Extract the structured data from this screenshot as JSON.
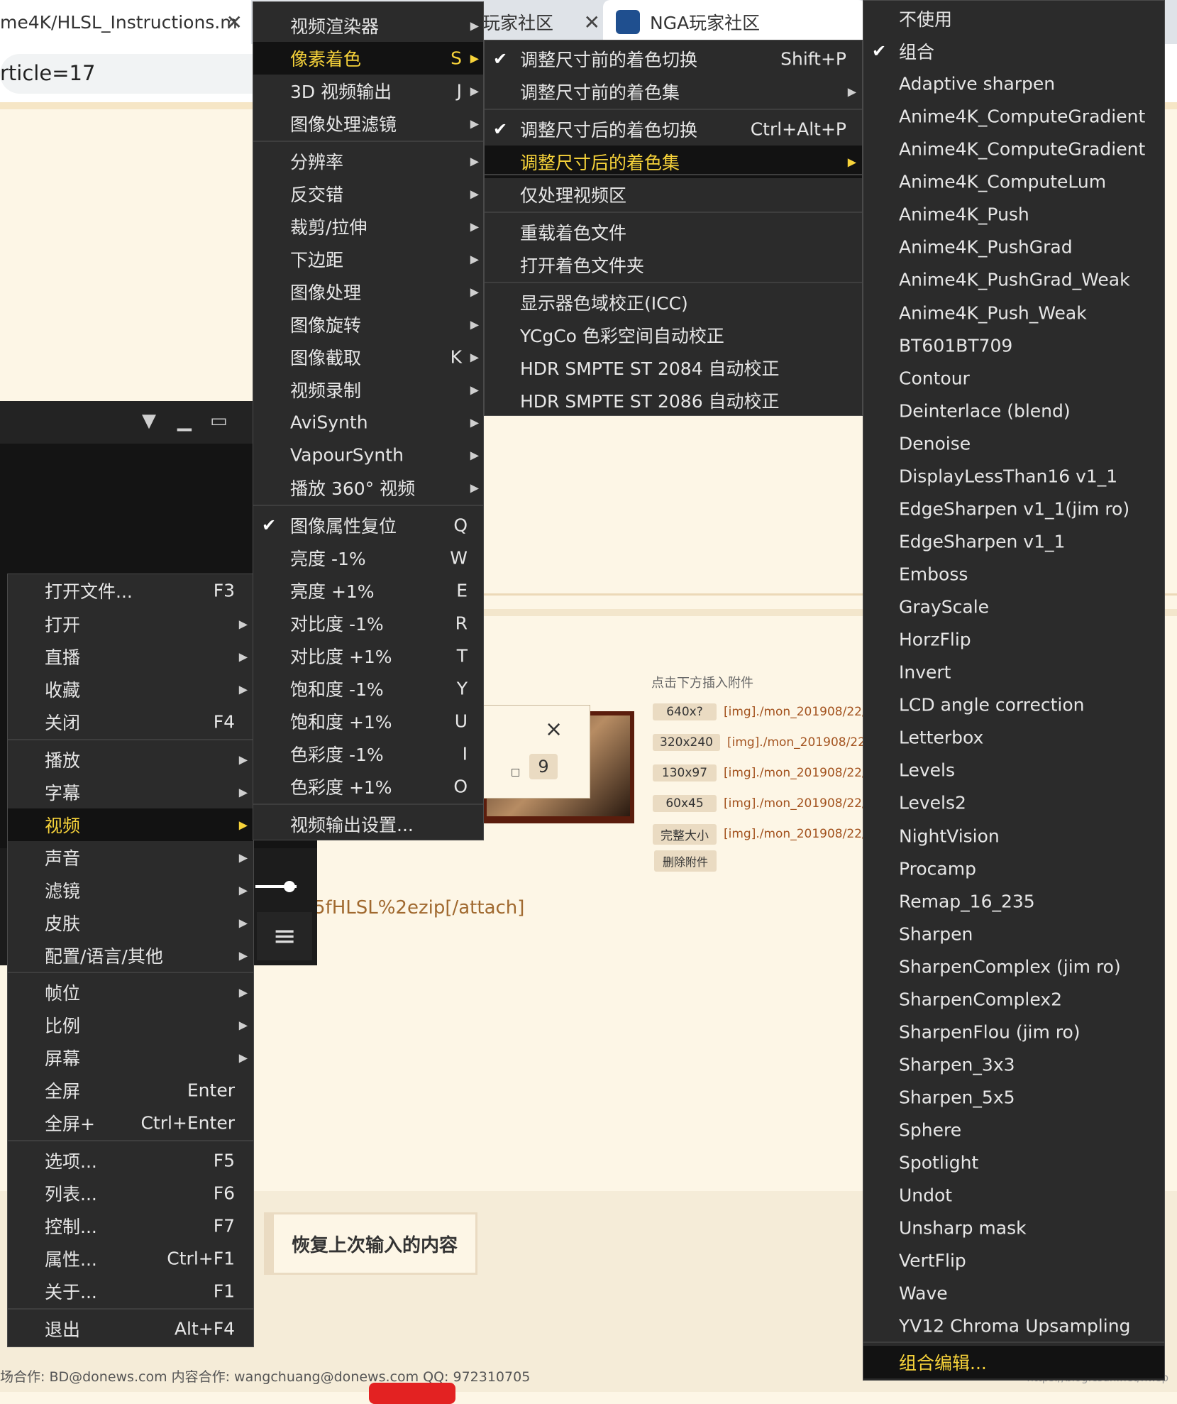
{
  "browser": {
    "tabs": [
      {
        "title": "me4K/HLSL_Instructions.m"
      },
      {
        "title": "玩家社区"
      },
      {
        "title": "NGA玩家社区"
      }
    ],
    "address": "rticle=17"
  },
  "menus": {
    "main": [
      {
        "label": "打开文件...",
        "shortcut": "F3"
      },
      {
        "label": "打开",
        "submenu": true
      },
      {
        "label": "直播",
        "submenu": true
      },
      {
        "label": "收藏",
        "submenu": true
      },
      {
        "label": "关闭",
        "shortcut": "F4"
      },
      {
        "label": "播放",
        "submenu": true
      },
      {
        "label": "字幕",
        "submenu": true
      },
      {
        "label": "视频",
        "submenu": true,
        "selected": true
      },
      {
        "label": "声音",
        "submenu": true
      },
      {
        "label": "滤镜",
        "submenu": true
      },
      {
        "label": "皮肤",
        "submenu": true
      },
      {
        "label": "配置/语言/其他",
        "submenu": true
      },
      {
        "label": "帧位",
        "submenu": true
      },
      {
        "label": "比例",
        "submenu": true
      },
      {
        "label": "屏幕",
        "submenu": true
      },
      {
        "label": "全屏",
        "shortcut": "Enter"
      },
      {
        "label": "全屏+",
        "shortcut": "Ctrl+Enter"
      },
      {
        "label": "选项...",
        "shortcut": "F5"
      },
      {
        "label": "列表...",
        "shortcut": "F6"
      },
      {
        "label": "控制...",
        "shortcut": "F7"
      },
      {
        "label": "属性...",
        "shortcut": "Ctrl+F1"
      },
      {
        "label": "关于...",
        "shortcut": "F1"
      },
      {
        "label": "退出",
        "shortcut": "Alt+F4"
      }
    ],
    "video": [
      {
        "label": "视频渲染器",
        "submenu": true
      },
      {
        "label": "像素着色",
        "shortcut": "S",
        "submenu": true,
        "selected": true
      },
      {
        "label": "3D 视频输出",
        "shortcut": "J",
        "submenu": true
      },
      {
        "label": "图像处理滤镜",
        "submenu": true
      },
      {
        "label": "分辨率",
        "submenu": true
      },
      {
        "label": "反交错",
        "submenu": true
      },
      {
        "label": "裁剪/拉伸",
        "submenu": true
      },
      {
        "label": "下边距",
        "submenu": true
      },
      {
        "label": "图像处理",
        "submenu": true
      },
      {
        "label": "图像旋转",
        "submenu": true
      },
      {
        "label": "图像截取",
        "shortcut": "K",
        "submenu": true
      },
      {
        "label": "视频录制",
        "submenu": true
      },
      {
        "label": "AviSynth",
        "submenu": true
      },
      {
        "label": "VapourSynth",
        "submenu": true
      },
      {
        "label": "播放 360° 视频",
        "submenu": true
      },
      {
        "label": "图像属性复位",
        "shortcut": "Q",
        "checked": true
      },
      {
        "label": "亮度 -1%",
        "shortcut": "W"
      },
      {
        "label": "亮度 +1%",
        "shortcut": "E"
      },
      {
        "label": "对比度 -1%",
        "shortcut": "R"
      },
      {
        "label": "对比度 +1%",
        "shortcut": "T"
      },
      {
        "label": "饱和度 -1%",
        "shortcut": "Y"
      },
      {
        "label": "饱和度 +1%",
        "shortcut": "U"
      },
      {
        "label": "色彩度 -1%",
        "shortcut": "I"
      },
      {
        "label": "色彩度 +1%",
        "shortcut": "O"
      },
      {
        "label": "视频输出设置..."
      }
    ],
    "shader": [
      {
        "label": "调整尺寸前的着色切换",
        "shortcut": "Shift+P",
        "checked": true
      },
      {
        "label": "调整尺寸前的着色集",
        "submenu": true
      },
      {
        "label": "调整尺寸后的着色切换",
        "shortcut": "Ctrl+Alt+P",
        "checked": true
      },
      {
        "label": "调整尺寸后的着色集",
        "submenu": true,
        "selected": true
      },
      {
        "label": "仅处理视频区"
      },
      {
        "label": "重载着色文件"
      },
      {
        "label": "打开着色文件夹"
      },
      {
        "label": "显示器色域校正(ICC)"
      },
      {
        "label": "YCgCo 色彩空间自动校正"
      },
      {
        "label": "HDR SMPTE ST 2084 自动校正"
      },
      {
        "label": "HDR SMPTE ST 2086 自动校正"
      }
    ],
    "shader_sets": [
      {
        "label": "不使用"
      },
      {
        "label": "组合",
        "checked": true
      },
      {
        "label": "Adaptive sharpen"
      },
      {
        "label": "Anime4K_ComputeGradient"
      },
      {
        "label": "Anime4K_ComputeGradient"
      },
      {
        "label": "Anime4K_ComputeLum"
      },
      {
        "label": "Anime4K_Push"
      },
      {
        "label": "Anime4K_PushGrad"
      },
      {
        "label": "Anime4K_PushGrad_Weak"
      },
      {
        "label": "Anime4K_Push_Weak"
      },
      {
        "label": "BT601BT709"
      },
      {
        "label": "Contour"
      },
      {
        "label": "Deinterlace (blend)"
      },
      {
        "label": "Denoise"
      },
      {
        "label": "DisplayLessThan16 v1_1"
      },
      {
        "label": "EdgeSharpen v1_1(jim ro)"
      },
      {
        "label": "EdgeSharpen v1_1"
      },
      {
        "label": "Emboss"
      },
      {
        "label": "GrayScale"
      },
      {
        "label": "HorzFlip"
      },
      {
        "label": "Invert"
      },
      {
        "label": "LCD angle correction"
      },
      {
        "label": "Letterbox"
      },
      {
        "label": "Levels"
      },
      {
        "label": "Levels2"
      },
      {
        "label": "NightVision"
      },
      {
        "label": "Procamp"
      },
      {
        "label": "Remap_16_235"
      },
      {
        "label": "Sharpen"
      },
      {
        "label": "SharpenComplex (jim ro)"
      },
      {
        "label": "SharpenComplex2"
      },
      {
        "label": "SharpenFlou (jim ro)"
      },
      {
        "label": "Sharpen_3x3"
      },
      {
        "label": "Sharpen_5x5"
      },
      {
        "label": "Sphere"
      },
      {
        "label": "Spotlight"
      },
      {
        "label": "Undot"
      },
      {
        "label": "Unsharp mask"
      },
      {
        "label": "VertFlip"
      },
      {
        "label": "Wave"
      },
      {
        "label": "YV12 Chroma Upsampling"
      },
      {
        "label": "组合编辑...",
        "selected": true
      }
    ]
  },
  "attachments": {
    "title": "点击下方插入附件",
    "rows": [
      {
        "size": "640x?",
        "link": "[img]./mon_201908/22/"
      },
      {
        "size": "320x240",
        "link": "[img]./mon_201908/22/"
      },
      {
        "size": "130x97",
        "link": "[img]./mon_201908/22/"
      },
      {
        "size": "60x45",
        "link": "[img]./mon_201908/22/"
      },
      {
        "size": "完整大小",
        "link": "[img]./mon_201908/22/"
      }
    ],
    "delete_label": "删除附件"
  },
  "popup": {
    "close": "×",
    "square": "□",
    "value": "9"
  },
  "code_text": "5fHLSL%2ezip[/attach]",
  "restore_label": "恢复上次输入的内容",
  "footer": "场合作: BD@donews.com 内容合作: wangchuang@donews.com QQ: 972310705",
  "watermark": "https://blog.csdn.net/hwsp",
  "colors": {
    "menu_bg": "#2b2b2b",
    "highlight_text": "#f7d33a",
    "page_bg": "#fdf6e6"
  }
}
